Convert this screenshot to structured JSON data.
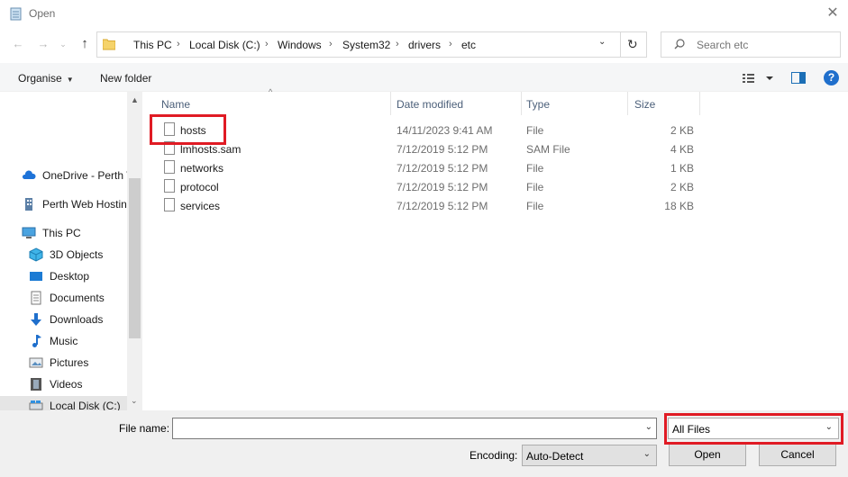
{
  "window": {
    "title": "Open",
    "close_glyph": "✕"
  },
  "nav": {
    "back_glyph": "←",
    "forward_glyph": "→",
    "recent_glyph": "⌄",
    "up_glyph": "↑",
    "breadcrumbs": [
      "This PC",
      "Local Disk (C:)",
      "Windows",
      "System32",
      "drivers",
      "etc"
    ],
    "separator": "›",
    "dropdown_glyph": "⌄",
    "refresh_glyph": "↻",
    "search_placeholder": "Search etc"
  },
  "commands": {
    "organise": "Organise",
    "caret": "▼",
    "new_folder": "New folder",
    "help": "?"
  },
  "sidebar": {
    "items": [
      {
        "label": "OneDrive - Perth W",
        "icon": "cloud-icon"
      },
      {
        "label": "Perth Web Hostin",
        "icon": "building-icon"
      },
      {
        "label": "This PC",
        "icon": "computer-icon"
      },
      {
        "label": "3D Objects",
        "icon": "cube-icon"
      },
      {
        "label": "Desktop",
        "icon": "desktop-icon"
      },
      {
        "label": "Documents",
        "icon": "documents-icon"
      },
      {
        "label": "Downloads",
        "icon": "downloads-icon"
      },
      {
        "label": "Music",
        "icon": "music-icon"
      },
      {
        "label": "Pictures",
        "icon": "pictures-icon"
      },
      {
        "label": "Videos",
        "icon": "videos-icon"
      },
      {
        "label": "Local Disk (C:)",
        "icon": "drive-icon"
      }
    ],
    "scroll_up": "▲",
    "scroll_down": "⌄"
  },
  "filelist": {
    "columns": {
      "name": "Name",
      "date": "Date modified",
      "type": "Type",
      "size": "Size"
    },
    "sort_glyph": "^",
    "rows": [
      {
        "name": "hosts",
        "date": "14/11/2023 9:41 AM",
        "type": "File",
        "size": "2 KB"
      },
      {
        "name": "lmhosts.sam",
        "date": "7/12/2019 5:12 PM",
        "type": "SAM File",
        "size": "4 KB"
      },
      {
        "name": "networks",
        "date": "7/12/2019 5:12 PM",
        "type": "File",
        "size": "1 KB"
      },
      {
        "name": "protocol",
        "date": "7/12/2019 5:12 PM",
        "type": "File",
        "size": "2 KB"
      },
      {
        "name": "services",
        "date": "7/12/2019 5:12 PM",
        "type": "File",
        "size": "18 KB"
      }
    ]
  },
  "bottom": {
    "file_name_label": "File name:",
    "file_name_value": "",
    "dropdown_glyph": "⌄",
    "file_type": "All Files",
    "encoding_label": "Encoding:",
    "encoding_value": "Auto-Detect",
    "open_label": "Open",
    "cancel_label": "Cancel"
  },
  "colors": {
    "highlight": "#e01b24",
    "accent": "#1f6fcc"
  }
}
